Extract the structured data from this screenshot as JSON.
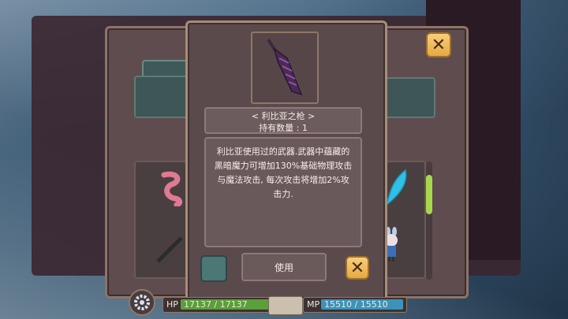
{
  "item": {
    "name": "< 利比亚之枪 >",
    "quantity": "持有数量 : 1",
    "description_lines": [
      "利比亚使用过的武器.武器中蕴藏的",
      "黑暗魔力可增加130%基础物理攻击",
      "与魔法攻击, 每次攻击将增加2%攻",
      "击力."
    ]
  },
  "buttons": {
    "use_label": "使用",
    "close_glyph": "✕"
  },
  "status": {
    "hp_label": "HP",
    "hp_value": "17137 / 17137",
    "hp_fraction": 1.0,
    "mp_label": "MP",
    "mp_value": "15510 / 15510",
    "mp_fraction": 1.0
  },
  "colors": {
    "accent_gold": "#e6a944",
    "hp": "#5a9f3a",
    "mp": "#3c93b8",
    "teal_slot": "#4b7775",
    "scroll_thumb": "#a8d84a"
  },
  "icons": [
    "spear-item-icon",
    "close-icon",
    "pink-tentacle-item-icon",
    "blue-crystal-item-icon",
    "gear-icon",
    "character-sprite"
  ]
}
